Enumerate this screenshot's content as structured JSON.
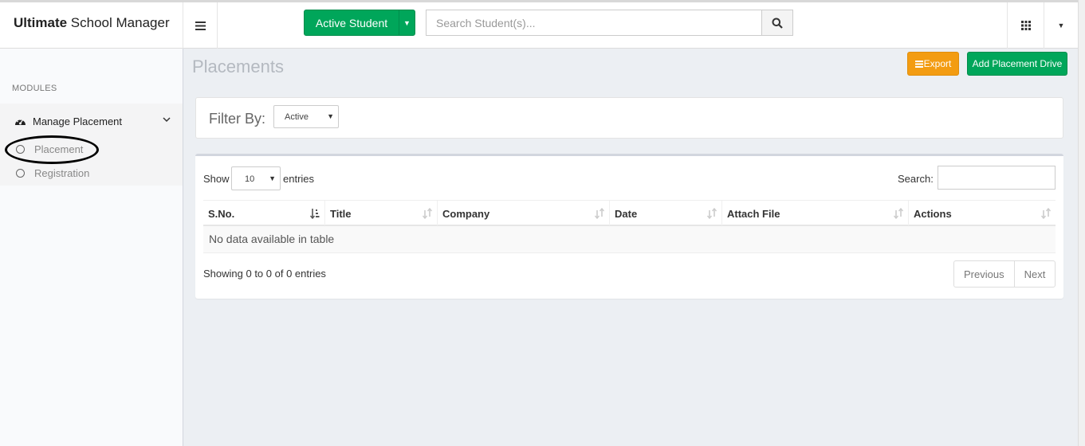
{
  "header": {
    "brand_bold": "Ultimate",
    "brand_rest": " School Manager",
    "student_button": "Active Student",
    "search_placeholder": "Search Student(s)..."
  },
  "sidebar": {
    "modules_label": "MODULES",
    "group_label": "Manage Placement",
    "items": [
      {
        "label": "Placement"
      },
      {
        "label": "Registration"
      }
    ]
  },
  "page": {
    "title": "Placements",
    "export_label": "Export",
    "add_label": "Add Placement Drive"
  },
  "filter": {
    "label": "Filter By:",
    "value": "Active"
  },
  "table": {
    "show_label": "Show",
    "length_value": "10",
    "entries_label": "entries",
    "search_label": "Search:",
    "columns": [
      "S.No.",
      "Title",
      "Company",
      "Date",
      "Attach File",
      "Actions"
    ],
    "empty_text": "No data available in table",
    "info_text": "Showing 0 to 0 of 0 entries",
    "prev_label": "Previous",
    "next_label": "Next"
  },
  "colors": {
    "green": "#00a65a",
    "orange": "#f39c12",
    "title_gray": "#b4b9c0"
  }
}
